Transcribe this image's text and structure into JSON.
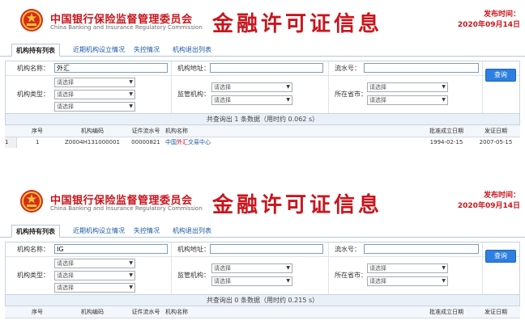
{
  "colors": {
    "title_red": "#c8161d",
    "link_blue": "#1b5aa8",
    "button_blue": "#2d7fe0",
    "highlight_red": "#d0021b"
  },
  "panels": [
    {
      "header": {
        "org_cn": "中国银行保险监督管理委员会",
        "org_en": "China Banking and Insurance Regulatory Commission",
        "title": "金融许可证信息",
        "publish_label": "发布时间：",
        "publish_date": "2020年09月14日",
        "emblem_icon": "national-emblem-icon"
      },
      "tabs": [
        "机构持有列表",
        "近期机构设立情况",
        "失控情况",
        "机构退出列表"
      ],
      "search": {
        "name_label": "机构名称：",
        "name_value": "外汇",
        "address_label": "机构地址：",
        "address_value": "",
        "serial_label": "流水号：",
        "serial_value": "",
        "type_label": "机构类型：",
        "regulator_label": "监管机构：",
        "province_label": "所在省市：",
        "select_placeholder": "请选择",
        "query_button": "查询"
      },
      "summary": "共查询出 1 条数据（用时约 0.062 s）",
      "table": {
        "columns": [
          "序号",
          "机构编码",
          "证件流水号",
          "机构名称",
          "批准成立日期",
          "发证日期"
        ],
        "rows": [
          {
            "row_index": "1",
            "no": "1",
            "code": "Z0004H131000001",
            "serial": "00000821",
            "name_prefix": "中国",
            "name_highlight": "外汇",
            "name_suffix": "交易中心",
            "established": "1994-02-15",
            "issued": "2007-05-15"
          }
        ]
      }
    },
    {
      "header": {
        "org_cn": "中国银行保险监督管理委员会",
        "org_en": "China Banking and Insurance Regulatory Commission",
        "title": "金融许可证信息",
        "publish_label": "发布时间：",
        "publish_date": "2020年09月14日",
        "emblem_icon": "national-emblem-icon"
      },
      "tabs": [
        "机构持有列表",
        "近期机构设立情况",
        "失控情况",
        "机构退出列表"
      ],
      "search": {
        "name_label": "机构名称：",
        "name_value": "IG",
        "address_label": "机构地址：",
        "address_value": "",
        "serial_label": "流水号：",
        "serial_value": "",
        "type_label": "机构类型：",
        "regulator_label": "监管机构：",
        "province_label": "所在省市：",
        "select_placeholder": "请选择",
        "query_button": "查询"
      },
      "summary": "共查询出 0 条数据（用时约 0.215 s）",
      "table": {
        "columns": [
          "序号",
          "机构编码",
          "证件流水号",
          "机构名称",
          "批准成立日期",
          "发证日期"
        ],
        "rows": []
      }
    }
  ]
}
